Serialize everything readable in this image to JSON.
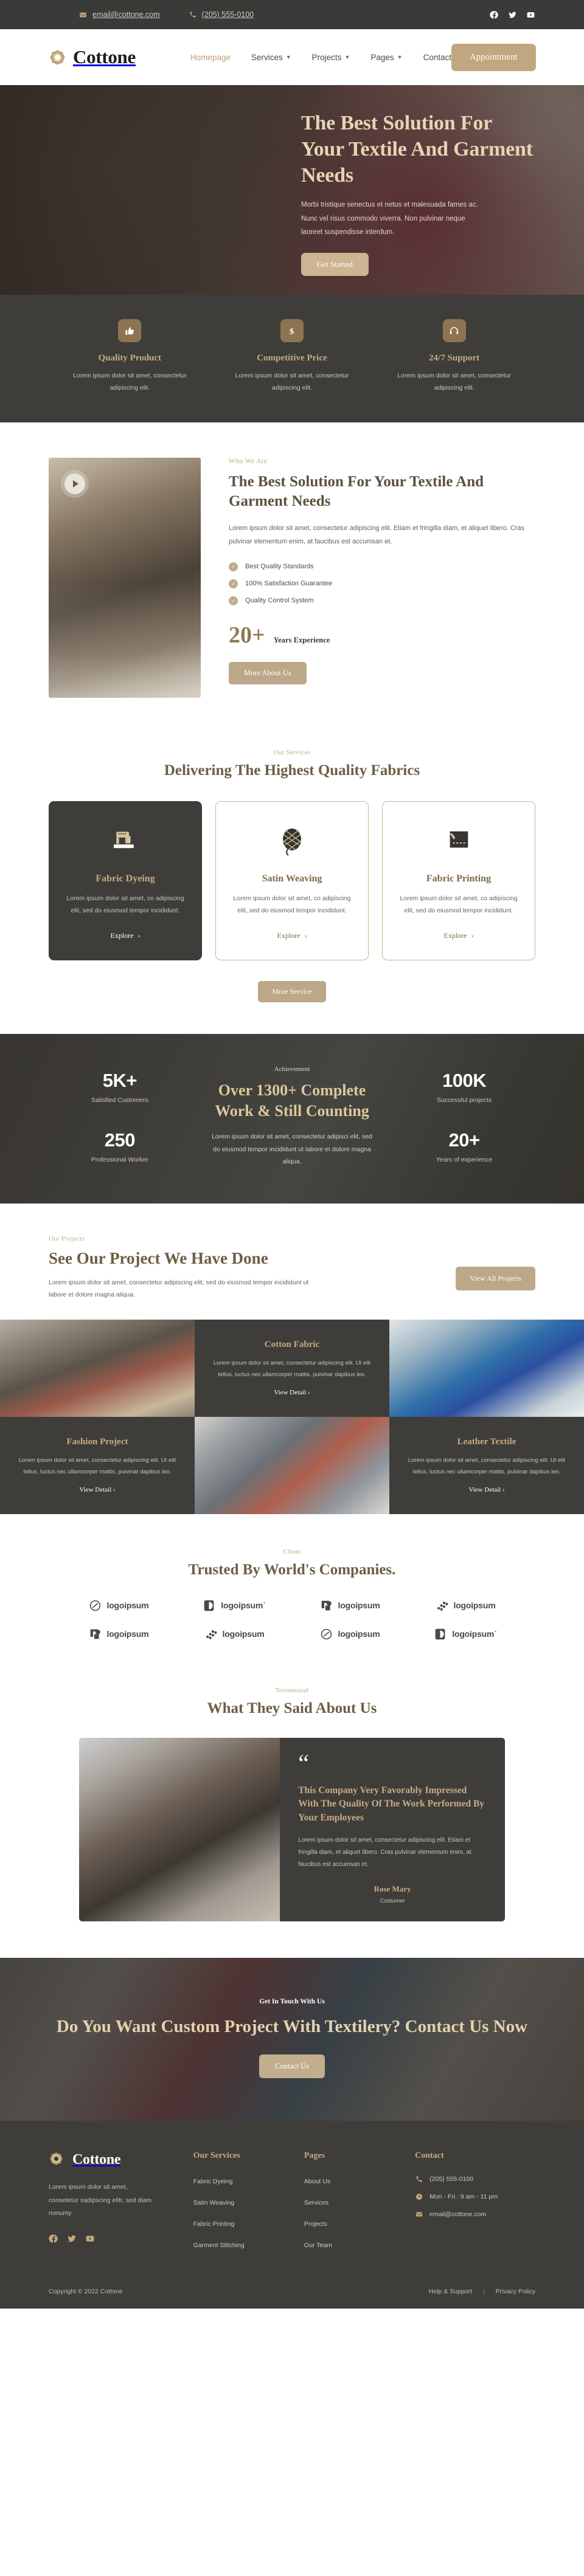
{
  "brand": {
    "name": "Cottone",
    "logo_icon": "flower-emblem-icon"
  },
  "topbar": {
    "email": "email@cottone.com",
    "phone": "(205) 555-0100",
    "email_icon": "envelope-icon",
    "phone_icon": "phone-icon",
    "social": [
      {
        "name": "facebook-icon",
        "label": "Facebook"
      },
      {
        "name": "twitter-icon",
        "label": "Twitter"
      },
      {
        "name": "youtube-icon",
        "label": "YouTube"
      }
    ]
  },
  "nav": {
    "items": [
      {
        "label": "Homepage",
        "active": true,
        "dropdown": false
      },
      {
        "label": "Services",
        "active": false,
        "dropdown": true
      },
      {
        "label": "Projects",
        "active": false,
        "dropdown": true
      },
      {
        "label": "Pages",
        "active": false,
        "dropdown": true
      },
      {
        "label": "Contact",
        "active": false,
        "dropdown": false
      }
    ],
    "cta_label": "Appointment"
  },
  "hero": {
    "title": "The Best Solution For Your Textile And Garment Needs",
    "paragraph": "Morbi tristique senectus et netus et malesuada fames ac. Nunc vel risus commodo viverra. Non pulvinar neque laoreet suspendisse interdum.",
    "button": "Get Started"
  },
  "features": [
    {
      "icon": "thumbs-up-icon",
      "glyph": "👍",
      "title": "Quality Product",
      "text": "Lorem ipsum dolor sit amet, consectetur adipiscing elit."
    },
    {
      "icon": "dollar-icon",
      "glyph": "$",
      "title": "Competitive Price",
      "text": "Lorem ipsum dolor sit amet, consectetur adipiscing elit."
    },
    {
      "icon": "headset-icon",
      "glyph": "🎧",
      "title": "24/7 Support",
      "text": "Lorem ipsum dolor sit amet, consectetur adipiscing elit."
    }
  ],
  "about": {
    "eyebrow": "Who We Are",
    "title": "The Best Solution For Your Textile And Garment Needs",
    "paragraph": "Lorem ipsum dolor sit amet, consectetur adipiscing elit. Etiam et fringilla diam, et aliquet libero. Cras pulvinar elementum enim, at faucibus est accumsan et.",
    "checks": [
      "Best Quality Standards",
      "100% Satisfaction Guarantee",
      "Quality Control System"
    ],
    "years_number": "20+",
    "years_label": "Years Experience",
    "button": "More About Us",
    "play_icon": "play-button-icon"
  },
  "services": {
    "eyebrow": "Our Services",
    "title": "Delivering The Highest Quality Fabrics",
    "cards": [
      {
        "icon": "sewing-machine-icon",
        "title": "Fabric Dyeing",
        "text": "Lorem ipsum dolor sit amet, co adipiscing elit, sed do eiusmod tempor incididunt.",
        "link": "Explore",
        "dark": true
      },
      {
        "icon": "yarn-ball-icon",
        "title": "Satin Weaving",
        "text": "Lorem ipsum dolor sit amet, co adipiscing elit, sed do eiusmod tempor incididunt.",
        "link": "Explore",
        "dark": false
      },
      {
        "icon": "fabric-printing-icon",
        "title": "Fabric Printing",
        "text": "Lorem ipsum dolor sit amet, co adipiscing elit, sed do eiusmod tempor incididunt.",
        "link": "Explore",
        "dark": false
      }
    ],
    "more_button": "More Service"
  },
  "achievement": {
    "eyebrow": "Achievement",
    "title": "Over 1300+ Complete Work & Still Counting",
    "paragraph": "Lorem ipsum dolor sit amet, consectetur adipisci elit, sed do eiusmod tempor incididunt ut labore et dolore magna aliqua.",
    "stats_left": [
      {
        "number": "5K+",
        "label": "Satisfied Customers"
      },
      {
        "number": "250",
        "label": "Professional Worker"
      }
    ],
    "stats_right": [
      {
        "number": "100K",
        "label": "Successful projects"
      },
      {
        "number": "20+",
        "label": "Years of experience"
      }
    ]
  },
  "projects": {
    "eyebrow": "Our Projects",
    "title": "See Our Project We Have Done",
    "paragraph": "Lorem ipsum dolor sit amet, consectetur adipiscing elit, sed do eiusmod tempor incididunt ut labore et dolore magna aliqua.",
    "button": "View All Projects",
    "items": [
      {
        "title": "Cotton Fabric",
        "text": "Lorem ipsum dolor sit amet, consectetur adipiscing elit. Ut elit tellus, luctus nec ullamcorper mattis, pulvinar dapibus leo.",
        "link": "View Detail"
      },
      {
        "title": "Fashion Project",
        "text": "Lorem ipsum dolor sit amet, consectetur adipiscing elit. Ut elit tellus, luctus nec ullamcorper mattis, pulvinar dapibus leo.",
        "link": "View Detail"
      },
      {
        "title": "Leather Textile",
        "text": "Lorem ipsum dolor sit amet, consectetur adipiscing elit. Ut elit tellus, luctus nec ullamcorper mattis, pulvinar dapibus leo.",
        "link": "View Detail"
      }
    ]
  },
  "clients": {
    "eyebrow": "Client",
    "title": "Trusted By World's Companies.",
    "logos": [
      {
        "text": "logoipsum",
        "mark": "oval-swirl-logo-icon"
      },
      {
        "text": "logoipsum˙",
        "mark": "half-circle-logo-icon"
      },
      {
        "text": "logoipsum",
        "mark": "square-dot-logo-icon"
      },
      {
        "text": "logoipsum",
        "mark": "dots-slant-logo-icon"
      },
      {
        "text": "logoipsum",
        "mark": "square-dot-logo-icon"
      },
      {
        "text": "logoipsum",
        "mark": "dots-slant-logo-icon"
      },
      {
        "text": "logoipsum",
        "mark": "oval-swirl-logo-icon"
      },
      {
        "text": "logoipsum˙",
        "mark": "half-circle-logo-icon"
      }
    ]
  },
  "testimonial": {
    "eyebrow": "Testimonial",
    "title": "What They Said About Us",
    "quote_icon": "quote-mark-icon",
    "headline": "This Company Very Favorably Impressed With The Quality Of The Work Performed By Your Employees",
    "body": "Lorem ipsum dolor sit amet, consectetur adipiscing elit. Etiam et fringilla diam, et aliquet libero. Cras pulvinar elementum enim, at faucibus est accumsan et.",
    "author": "Rose Mary",
    "role": "Costumer"
  },
  "cta": {
    "eyebrow": "Get In Touch With Us",
    "title": "Do You Want Custom Project With Textilery? Contact Us Now",
    "button": "Contact Us"
  },
  "footer": {
    "about": "Lorem ipsum dolor sit amet, consetetur sadipscing elitr, sed diam nonumy",
    "social": [
      {
        "name": "facebook-icon"
      },
      {
        "name": "twitter-icon"
      },
      {
        "name": "youtube-icon"
      }
    ],
    "columns": [
      {
        "heading": "Our Services",
        "links": [
          "Fabric Dyeing",
          "Satin Weaving",
          "Fabric Printing",
          "Garment Stitching"
        ]
      },
      {
        "heading": "Pages",
        "links": [
          "About Us",
          "Services",
          "Projects",
          "Our Team"
        ]
      }
    ],
    "contact_heading": "Contact",
    "contact": [
      {
        "icon": "phone-icon",
        "text": "(205) 555-0100"
      },
      {
        "icon": "clock-icon",
        "text": "Mon - Fri : 9 am - 11 pm"
      },
      {
        "icon": "envelope-icon",
        "text": "email@cottone.com"
      }
    ],
    "copyright": "Copyright © 2022 Cottone",
    "help": "Help & Support",
    "separator": "|",
    "privacy": "Privacy Policy"
  },
  "colors": {
    "gold": "#c1a77f",
    "dark": "#3e3d3a",
    "heading": "#6b5f43",
    "cream": "#e5d5b4"
  }
}
